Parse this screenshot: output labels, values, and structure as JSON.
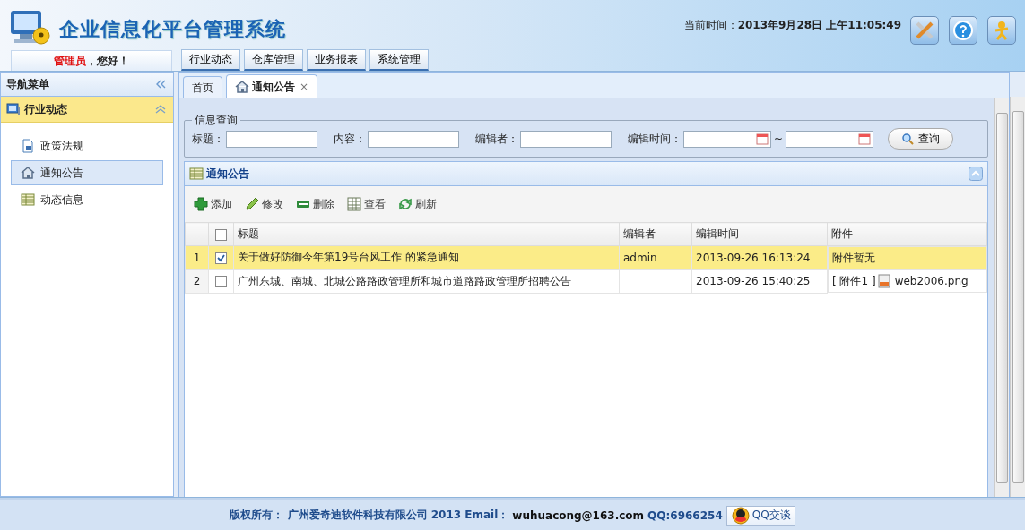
{
  "app_title": "企业信息化平台管理系统",
  "user": {
    "name": "管理员",
    "greeting": "，您好！"
  },
  "clock": {
    "label": "当前时间：",
    "value": "2013年9月28日 上午11:05:49"
  },
  "header_buttons": [
    {
      "kind": "tools"
    },
    {
      "kind": "help"
    },
    {
      "kind": "user"
    }
  ],
  "top_tabs": [
    {
      "label": "行业动态"
    },
    {
      "label": "仓库管理"
    },
    {
      "label": "业务报表"
    },
    {
      "label": "系统管理"
    }
  ],
  "sidebar": {
    "title": "导航菜单",
    "group": {
      "label": "行业动态",
      "expanded": true
    },
    "items": [
      {
        "label": "政策法规",
        "kind": "document",
        "selected": false
      },
      {
        "label": "通知公告",
        "kind": "home",
        "selected": true
      },
      {
        "label": "动态信息",
        "kind": "table",
        "selected": false
      }
    ]
  },
  "page_tabs": [
    {
      "label": "首页",
      "selected": false,
      "kind": "plain"
    },
    {
      "label": "通知公告",
      "selected": true,
      "kind": "home",
      "close": "×"
    }
  ],
  "query": {
    "legend": "信息查询",
    "fields": [
      {
        "label": "标题：",
        "kind": "text"
      },
      {
        "label": "内容：",
        "kind": "text"
      },
      {
        "label": "编辑者：",
        "kind": "text"
      },
      {
        "label": "编辑时间：",
        "kind": "daterange",
        "separator": "~"
      }
    ],
    "button": "查询"
  },
  "grid": {
    "title": "通知公告",
    "toolbar": [
      {
        "label": "添加",
        "kind": "add"
      },
      {
        "label": "修改",
        "kind": "edit"
      },
      {
        "label": "删除",
        "kind": "delete"
      },
      {
        "label": "查看",
        "kind": "view"
      },
      {
        "label": "刷新",
        "kind": "refresh"
      }
    ],
    "all_checked": false,
    "columns": [
      "标题",
      "编辑者",
      "编辑时间",
      "附件"
    ],
    "rows": [
      {
        "index": "1",
        "checked": true,
        "selected": true,
        "title": "关于做好防御今年第19号台风工作 的紧急通知",
        "editor": "admin",
        "time": "2013-09-26 16:13:24",
        "attachment": "附件暂无"
      },
      {
        "index": "2",
        "checked": false,
        "selected": false,
        "title": "广州东城、南城、北城公路路政管理所和城市道路路政管理所招聘公告",
        "time": "2013-09-26 15:40:25",
        "attachment": "[ 附件1 ]",
        "file": "web2006.png"
      }
    ]
  },
  "footer": {
    "copyright": "版权所有： 广州爱奇迪软件科技有限公司 2013 Email：",
    "email": "wuhuacong@163.com",
    "qq": "QQ:6966254",
    "qq_button": "QQ交谈"
  }
}
